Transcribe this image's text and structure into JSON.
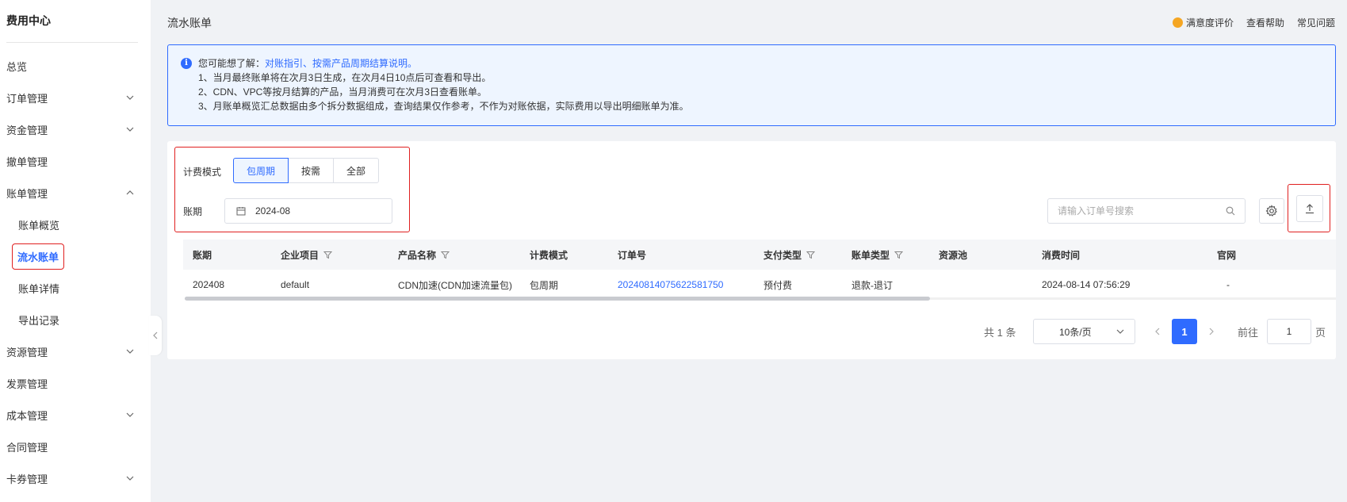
{
  "sidebar": {
    "title": "费用中心",
    "items": [
      {
        "label": "总览",
        "expandable": false
      },
      {
        "label": "订单管理",
        "expandable": true
      },
      {
        "label": "资金管理",
        "expandable": true
      },
      {
        "label": "撤单管理",
        "expandable": false
      },
      {
        "label": "账单管理",
        "expandable": true,
        "expanded": true
      },
      {
        "label": "账单概览",
        "sub": true
      },
      {
        "label": "流水账单",
        "sub": true,
        "active": true
      },
      {
        "label": "账单详情",
        "sub": true
      },
      {
        "label": "导出记录",
        "sub": true
      },
      {
        "label": "资源管理",
        "expandable": true
      },
      {
        "label": "发票管理",
        "expandable": false
      },
      {
        "label": "成本管理",
        "expandable": true
      },
      {
        "label": "合同管理",
        "expandable": false
      },
      {
        "label": "卡券管理",
        "expandable": true
      }
    ]
  },
  "header": {
    "title": "流水账单",
    "satisfaction": "满意度评价",
    "help": "查看帮助",
    "faq": "常见问题"
  },
  "info": {
    "prefix": "您可能想了解：",
    "link": "对账指引、按需产品周期结算说明。",
    "notes": [
      "1、当月最终账单将在次月3日生成，在次月4日10点后可查看和导出。",
      "2、CDN、VPC等按月结算的产品，当月消费可在次月3日查看账单。",
      "3、月账单概览汇总数据由多个拆分数据组成，查询结果仅作参考，不作为对账依据，实际费用以导出明细账单为准。"
    ]
  },
  "filters": {
    "billing_mode_label": "计费模式",
    "billing_modes": [
      "包周期",
      "按需",
      "全部"
    ],
    "active_mode": "包周期",
    "period_label": "账期",
    "period_value": "2024-08",
    "search_placeholder": "请输入订单号搜索"
  },
  "table": {
    "columns": [
      "账期",
      "企业项目",
      "产品名称",
      "计费模式",
      "订单号",
      "支付类型",
      "账单类型",
      "资源池",
      "消费时间",
      "官网"
    ],
    "filterable": [
      false,
      true,
      true,
      false,
      false,
      true,
      true,
      false,
      false,
      false
    ],
    "rows": [
      [
        "202408",
        "default",
        "CDN加速(CDN加速流量包)",
        "包周期",
        "20240814075622581750",
        "预付费",
        "退款-退订",
        "",
        "2024-08-14 07:56:29",
        "-"
      ]
    ]
  },
  "pagination": {
    "total": "共 1 条",
    "page_size": "10条/页",
    "current_page": "1",
    "goto_label": "前往",
    "goto_value": "1",
    "page_suffix": "页"
  },
  "colors": {
    "accent": "#2f6bff",
    "highlight_border": "#e02020",
    "info_bg": "#eef5ff"
  }
}
